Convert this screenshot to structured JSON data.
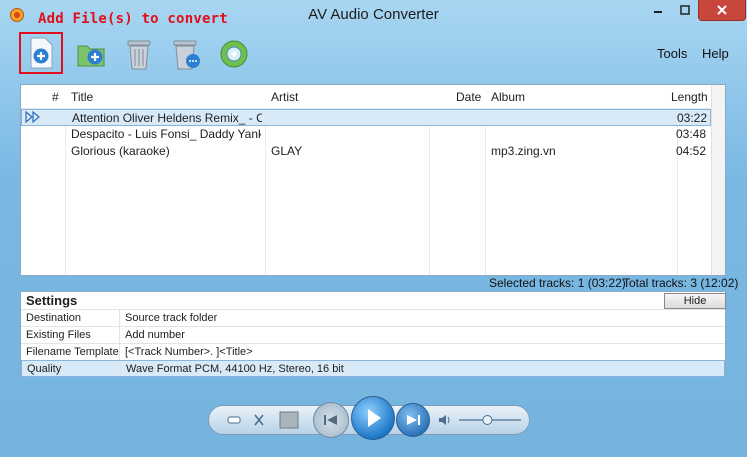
{
  "window": {
    "title": "AV Audio Converter",
    "annotation": "Add File(s) to convert"
  },
  "menu": {
    "tools": "Tools",
    "help": "Help"
  },
  "toolbar": {
    "icons": [
      "add-file-icon",
      "add-folder-icon",
      "delete-icon",
      "delete-all-icon",
      "convert-icon"
    ]
  },
  "tracklist": {
    "headers": {
      "num": "#",
      "title": "Title",
      "artist": "Artist",
      "date": "Date",
      "album": "Album",
      "length": "Length"
    },
    "rows": [
      {
        "title": "Attention Oliver Heldens Remix_ - Ch...",
        "artist": "",
        "date": "",
        "album": "",
        "length": "03:22"
      },
      {
        "title": "Despacito - Luis Fonsi_ Daddy Yank...",
        "artist": "",
        "date": "",
        "album": "",
        "length": "03:48"
      },
      {
        "title": "Glorious (karaoke)",
        "artist": "GLAY",
        "date": "",
        "album": "mp3.zing.vn",
        "length": "04:52"
      }
    ]
  },
  "status": {
    "selected": "Selected tracks: 1 (03:22)",
    "total": "Total tracks: 3 (12:02)"
  },
  "settings": {
    "title": "Settings",
    "hide_label": "Hide",
    "rows": [
      {
        "label": "Destination",
        "value": "Source track folder"
      },
      {
        "label": "Existing Files",
        "value": "Add number"
      },
      {
        "label": "Filename Template",
        "value": "[<Track Number>. ]<Title>"
      },
      {
        "label": "Quality",
        "value": "Wave Format PCM, 44100 Hz, Stereo, 16 bit"
      }
    ]
  },
  "player": {
    "volume_level": 0.45
  },
  "colors": {
    "accent": "#3a8ee6",
    "annotation": "#e0101a",
    "selection": "#d8eaf8"
  }
}
